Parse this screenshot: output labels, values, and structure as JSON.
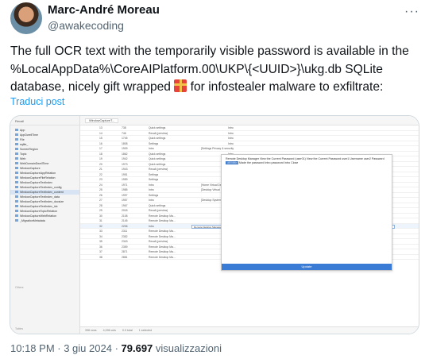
{
  "author": {
    "name": "Marc-André Moreau",
    "handle": "@awakecoding"
  },
  "tweet": {
    "line1": "The full OCR text with the temporarily visible password is available in the",
    "line2": "%LocalAppData%\\CoreAIPlatform.00\\UKP\\{<UUID>}\\ukg.db SQLite",
    "line3a": "database, nicely gift wrapped ",
    "gift_icon": "wrapped-gift-icon",
    "line3b": " for infostealer malware to exfiltrate:",
    "translate": "Traduci post"
  },
  "footer": {
    "time": "10:18 PM",
    "sep1": " · ",
    "date": "3 giu 2024",
    "sep2": " · ",
    "views": "79.697",
    "views_label": " visualizzazioni"
  },
  "screenshot": {
    "app_title": "Recall",
    "main_tab": "WindowCaptureT...",
    "sidebar_items": [
      "App",
      "AppDwellTime",
      "File",
      "sqlite_",
      "ScreenRegion",
      "Topic",
      "Web",
      "WebDomainDwellTime",
      "WindowCapture",
      "WindowCaptureAppRelation",
      "WindowCaptureFileRelation",
      "WindowCaptureTextIndex",
      "WindowCaptureTextIndex_config",
      "WindowCaptureTextIndex_content",
      "WindowCaptureTextIndex_data",
      "WindowCaptureTextIndex_docsize",
      "WindowCaptureTextIndex_idx",
      "WindowCaptureTopicRelation",
      "WindowCaptureWebRelation",
      "_MigrationMetadata"
    ],
    "selected_sidebar_index": 13,
    "sidebar_others": "Others",
    "sidebar_footer": "Tables",
    "rows": [
      [
        "13",
        "738",
        "Quick settings",
        "",
        "Intro"
      ],
      [
        "14",
        "746",
        "Recall (preview)",
        "",
        "Intro"
      ],
      [
        "15",
        "1745",
        "Quick settings",
        "",
        "Intro"
      ],
      [
        "16",
        "1808",
        "Settings",
        "",
        "Intro"
      ],
      [
        "17",
        "1909",
        "Intro",
        "[Settings Privacy & security",
        ""
      ],
      [
        "18",
        "1862",
        "Quick settings",
        "",
        "Intro"
      ],
      [
        "19",
        "1942",
        "Quick settings",
        "",
        "Intro"
      ],
      [
        "20",
        "1973",
        "Quick settings",
        "",
        "Intro"
      ],
      [
        "21",
        "1943",
        "Recall (preview)",
        "",
        "Intro"
      ],
      [
        "22",
        "1951",
        "Settings",
        "",
        "Intro"
      ],
      [
        "23",
        "1959",
        "Settings",
        "",
        "Intro"
      ],
      [
        "24",
        "1971",
        "Intro",
        "[Home Virtual Desktop Co...",
        ""
      ],
      [
        "25",
        "1985",
        "Intro",
        "[Desktop Virtual Desktop...",
        ""
      ],
      [
        "26",
        "1997",
        "Settings",
        "",
        "Intro"
      ],
      [
        "27",
        "1957",
        "Intro",
        "[Desktop System VCR 4U...",
        ""
      ],
      [
        "28",
        "1967",
        "Quick settings",
        "",
        "Intro"
      ],
      [
        "29",
        "2018",
        "Recall (preview)",
        "",
        "Intro"
      ],
      [
        "30",
        "2108",
        "Remote Desktop Ma...",
        "",
        "Intro"
      ],
      [
        "31",
        "2145",
        "Remote Desktop Ma...",
        "",
        "Intro"
      ],
      [
        "32",
        "2206",
        "Intro",
        "",
        ""
      ],
      [
        "33",
        "2311",
        "Remote Desktop Ma...",
        "",
        "Intro"
      ],
      [
        "34",
        "2352",
        "Remote Desktop Ma...",
        "",
        "Intro"
      ],
      [
        "35",
        "2343",
        "Recall (preview)",
        "",
        "Intro"
      ],
      [
        "36",
        "2359",
        "Remote Desktop Ma...",
        "",
        "Intro"
      ],
      [
        "37",
        "2871",
        "Remote Desktop Ma...",
        "",
        "Intro"
      ],
      [
        "38",
        "2881",
        "Remote Desktop Ma...",
        "",
        "Intro"
      ]
    ],
    "highlighted_row_index": 19,
    "highlight_field": "Remote Desktop Manager    View the Current Password (User01) View the Current Password user1  Username user2 Password 1800864 Made the password Intro",
    "popup": {
      "text_before": "Remote Desktop Manager    View the Current Password (user01) View the Current Password user1  Username user2 Password ",
      "password": "1800864",
      "text_after": " Made the password Intro password Intro Close",
      "button": "Update"
    },
    "status": [
      "398 rows",
      "4,096 cols",
      "0.0 total",
      "1 selected"
    ]
  }
}
